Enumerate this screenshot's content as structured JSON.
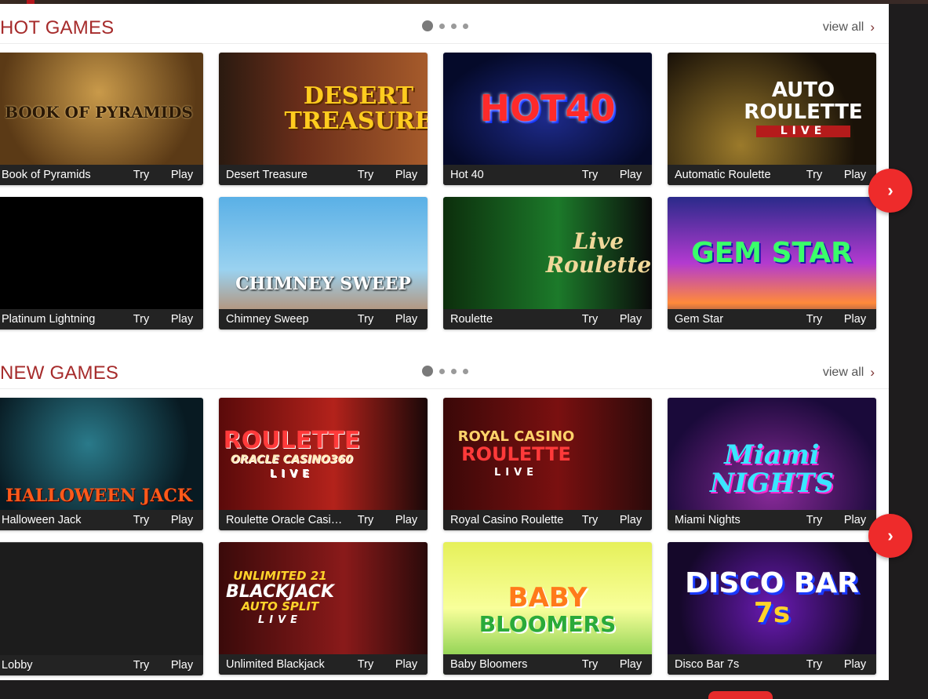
{
  "sections": [
    {
      "title": "HOT GAMES",
      "view_all": "view all",
      "games": [
        {
          "name": "Book of Pyramids",
          "art_title": "BOOK OF PYRAMIDS",
          "try": "Try",
          "play": "Play"
        },
        {
          "name": "Desert Treasure",
          "art_title": "DESERT TREASURE",
          "try": "Try",
          "play": "Play"
        },
        {
          "name": "Hot 40",
          "art_title": "HOT40",
          "try": "Try",
          "play": "Play"
        },
        {
          "name": "Automatic Roulette",
          "art_title": "AUTO ROULETTE",
          "art_sub": "LIVE",
          "try": "Try",
          "play": "Play"
        },
        {
          "name": "Platinum Lightning",
          "art_title": "",
          "try": "Try",
          "play": "Play"
        },
        {
          "name": "Chimney Sweep",
          "art_title": "CHIMNEY SWEEP",
          "try": "Try",
          "play": "Play"
        },
        {
          "name": "Roulette",
          "art_title": "Live Roulette",
          "try": "Try",
          "play": "Play"
        },
        {
          "name": "Gem Star",
          "art_title": "GEM STAR",
          "try": "Try",
          "play": "Play"
        }
      ]
    },
    {
      "title": "NEW GAMES",
      "view_all": "view all",
      "games": [
        {
          "name": "Halloween Jack",
          "art_title": "HALLOWEEN JACK",
          "try": "Try",
          "play": "Play"
        },
        {
          "name": "Roulette Oracle Casin...",
          "art_title": "ROULETTE",
          "art_sub": "ORACLE CASINO360",
          "art_live": "LIVE",
          "try": "Try",
          "play": "Play"
        },
        {
          "name": "Royal Casino Roulette",
          "art_top": "ROYAL CASINO",
          "art_title": "ROULETTE",
          "art_live": "LIVE",
          "try": "Try",
          "play": "Play"
        },
        {
          "name": "Miami Nights",
          "art_title": "Miami NIGHTS",
          "try": "Try",
          "play": "Play"
        },
        {
          "name": "Lobby",
          "art_title": "",
          "try": "Try",
          "play": "Play"
        },
        {
          "name": "Unlimited Blackjack",
          "art_top": "UNLIMITED 21",
          "art_title": "BLACKJACK",
          "art_sub": "AUTO SPLIT",
          "art_live": "LIVE",
          "try": "Try",
          "play": "Play"
        },
        {
          "name": "Baby Bloomers",
          "art_title": "BABY",
          "art_sub": "BLOOMERS",
          "try": "Try",
          "play": "Play"
        },
        {
          "name": "Disco Bar 7s",
          "art_title": "DISCO BAR",
          "art_sub": "7s",
          "try": "Try",
          "play": "Play"
        }
      ]
    }
  ],
  "carousel": {
    "dot_count": 4,
    "active_index": 0
  },
  "next_button": {
    "glyph": "›"
  },
  "view_all_chevron": "›",
  "colors": {
    "title": "#a62b2b",
    "accent": "#ee2b2b",
    "bar": "#232323"
  }
}
